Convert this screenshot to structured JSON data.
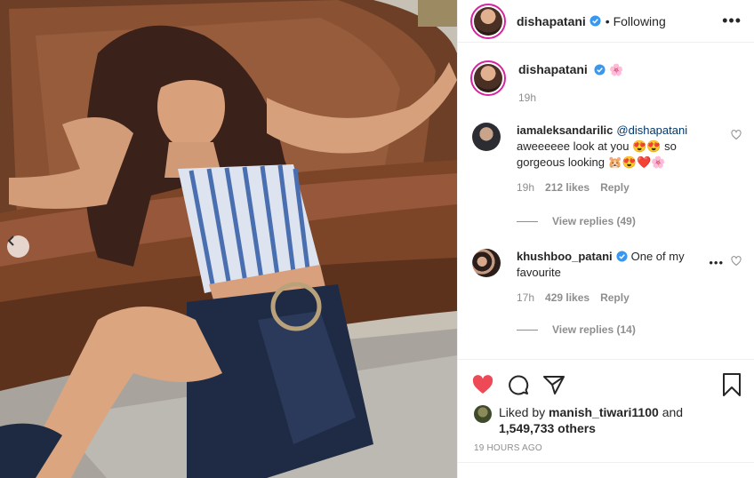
{
  "post": {
    "author": "dishapatani",
    "follow_status": "Following",
    "more_label": "•••",
    "caption_emoji": "🌸",
    "caption_time": "19h"
  },
  "comments": [
    {
      "username": "iamaleksandarilic",
      "mention": "@dishapatani",
      "text": "aweeeeee look at you 😍😍 so gorgeous looking 🐹😍❤️🌸",
      "time": "19h",
      "likes": "212 likes",
      "reply_label": "Reply",
      "view_replies": "View replies (49)"
    },
    {
      "username": "khushboo_patani",
      "text": "One of my favourite",
      "time": "17h",
      "likes": "429 likes",
      "reply_label": "Reply",
      "view_replies": "View replies (14)"
    }
  ],
  "likes": {
    "prefix": "Liked by",
    "user": "manish_tiwari1100",
    "connector": "and",
    "count": "1,549,733 others"
  },
  "timestamp": "19 HOURS AGO",
  "icons": {
    "like": "heart-icon",
    "comment": "comment-icon",
    "share": "share-icon",
    "save": "bookmark-icon",
    "prev": "chevron-left-icon",
    "verified": "verified-badge-icon"
  },
  "colors": {
    "like_red": "#ed4956",
    "verified_blue": "#3897f0",
    "muted": "#8e8e8e"
  }
}
